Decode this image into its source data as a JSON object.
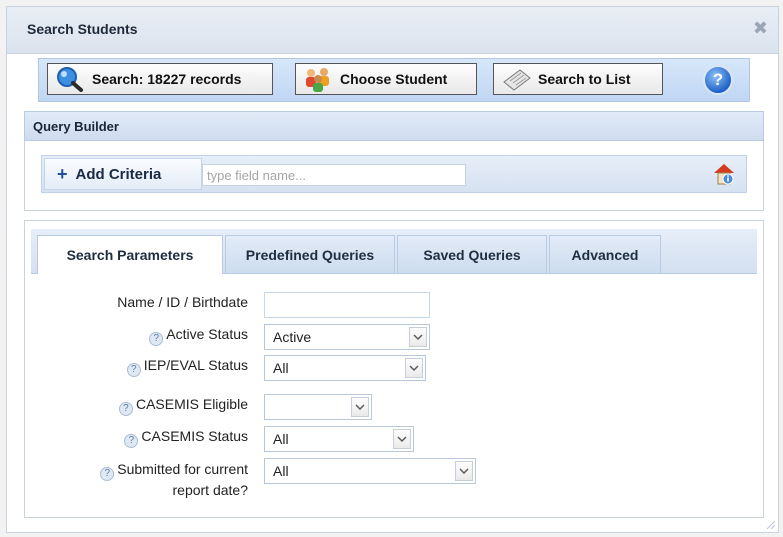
{
  "dialog": {
    "title": "Search Students",
    "close_glyph": "✖"
  },
  "toolbar": {
    "search_label": "Search: 18227 records",
    "choose_label": "Choose Student",
    "search_list_label": "Search to List",
    "help_glyph": "?"
  },
  "query_builder": {
    "title": "Query Builder",
    "add_glyph": "+",
    "add_label": "Add Criteria",
    "field_placeholder": "type field name..."
  },
  "tabs": [
    {
      "label": "Search Parameters",
      "active": true
    },
    {
      "label": "Predefined Queries",
      "active": false
    },
    {
      "label": "Saved Queries",
      "active": false
    },
    {
      "label": "Advanced",
      "active": false
    }
  ],
  "form": {
    "name_label": "Name / ID / Birthdate",
    "name_value": "",
    "active_status_label": "Active Status",
    "active_status_value": "Active",
    "iep_label": "IEP/EVAL Status",
    "iep_value": "All",
    "casemis_eligible_label": "CASEMIS Eligible",
    "casemis_eligible_value": "",
    "casemis_status_label": "CASEMIS Status",
    "casemis_status_value": "All",
    "submitted_label_line1": "Submitted for current",
    "submitted_label_line2": "report date?",
    "submitted_value": "All",
    "help_glyph": "?"
  },
  "colors": {
    "accent": "#1f63c8",
    "header_bg": "#dbe3ee",
    "toolbar_bg": "#c7dcf5"
  }
}
